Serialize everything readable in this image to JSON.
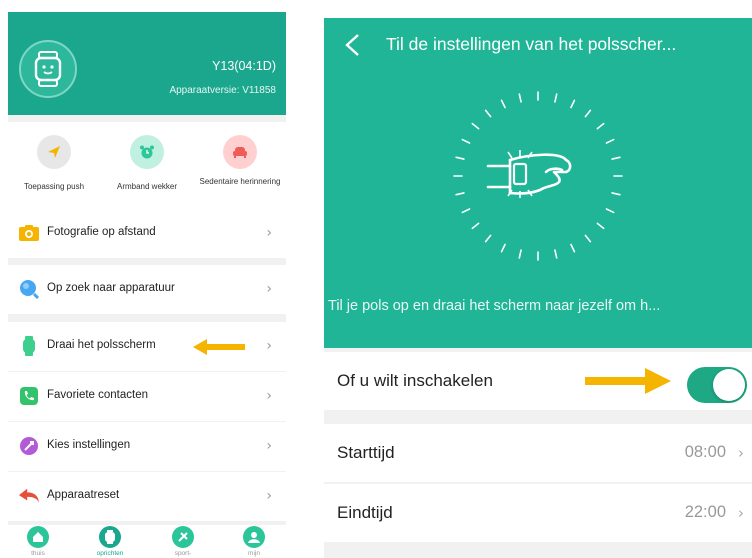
{
  "left_screen": {
    "device": {
      "name": "Y13(04:1D)",
      "version": "Apparaatversie: V11858"
    },
    "quick_actions": [
      {
        "label": "Toepassing push",
        "icon": "send-icon",
        "color": "#e7e7e7",
        "icon_color": "#f5b400"
      },
      {
        "label": "Armband wekker",
        "icon": "alarm-clock-icon",
        "color": "#bff0e0",
        "icon_color": "#2ec79a"
      },
      {
        "label": "Sedentaire herinnering",
        "icon": "sofa-icon",
        "color": "#ffd0cf",
        "icon_color": "#f05a57"
      }
    ],
    "menu": [
      {
        "label": "Fotografie op afstand",
        "icon": "camera-icon",
        "color": "#f5b400"
      },
      {
        "label": "Op zoek naar apparatuur",
        "icon": "search-icon",
        "color": "#47a7f0"
      },
      {
        "label": "Draai het polsscherm",
        "icon": "watch-icon",
        "color": "#3ecf8e"
      },
      {
        "label": "Favoriete contacten",
        "icon": "phone-contacts-icon",
        "color": "#34c36d"
      },
      {
        "label": "Kies instellingen",
        "icon": "settings-icon",
        "color": "#b35ad6"
      },
      {
        "label": "Apparaatreset",
        "icon": "reset-arrow-icon",
        "color": "#e84e3c"
      }
    ],
    "tabs": [
      {
        "label": "thuis",
        "icon": "home-icon",
        "color": "#2cc59a"
      },
      {
        "label": "oprichten",
        "icon": "watch-face-icon",
        "color": "#1aa78e"
      },
      {
        "label": "sport-",
        "icon": "sport-icon",
        "color": "#2cc59a"
      },
      {
        "label": "mijn",
        "icon": "profile-icon",
        "color": "#2cc59a"
      }
    ],
    "accent": "#1aa78e",
    "arrow_color": "#f5b400"
  },
  "right_screen": {
    "title": "Til de instellingen van het polsscher...",
    "description": "Til je pols op en draai het scherm naar jezelf om h...",
    "enable_label": "Of u wilt inschakelen",
    "enable_on": true,
    "start": {
      "label": "Starttijd",
      "value": "08:00"
    },
    "end": {
      "label": "Eindtijd",
      "value": "22:00"
    },
    "accent": "#1fb596",
    "toggle_color": "#1ea884"
  }
}
